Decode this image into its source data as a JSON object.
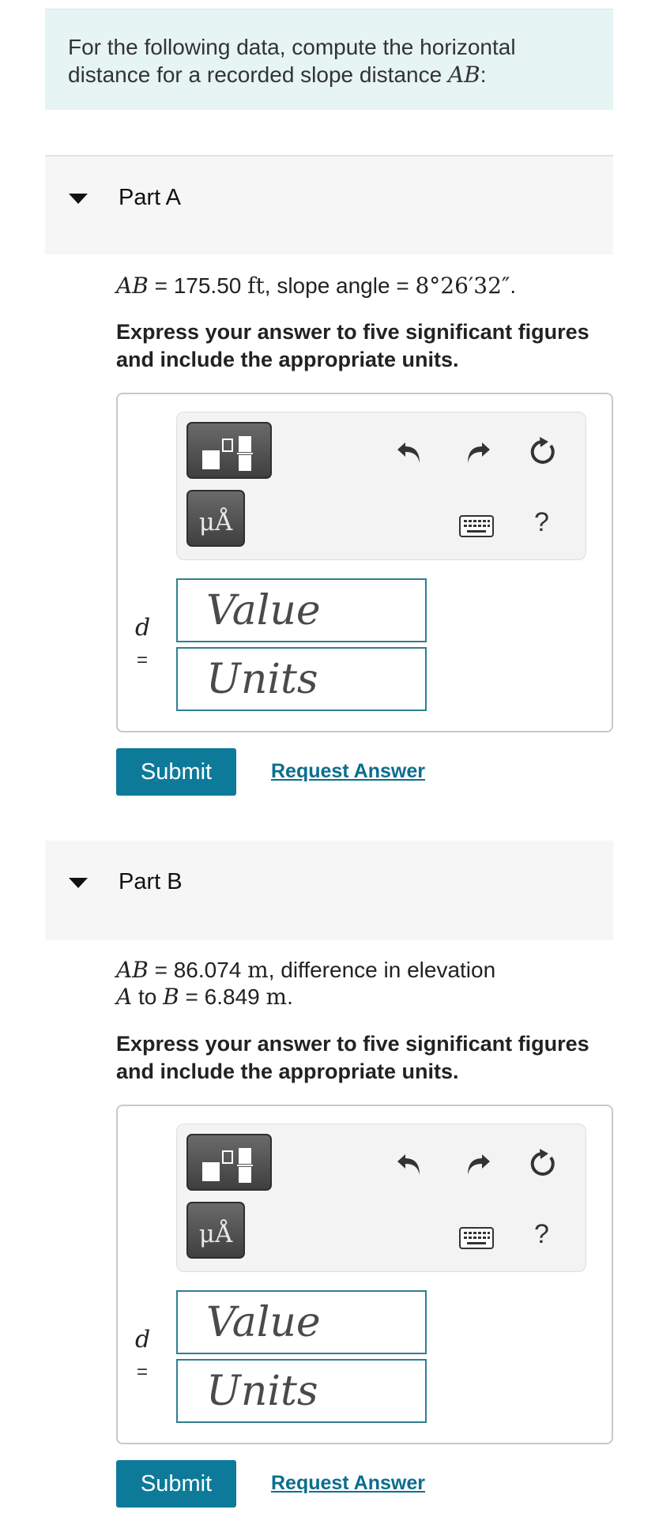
{
  "intro": {
    "text": "For the following data, compute the horizontal distance for a recorded slope distance ",
    "var": "AB",
    "suffix": ":"
  },
  "parts": [
    {
      "title": "Part A",
      "q_var": "AB",
      "q_eq": " = 175.50 ",
      "q_unit": "ft",
      "q_rest": ", slope angle = ",
      "q_angle": "8°26′32″",
      "q_end": ".",
      "instruction": "Express your answer to five significant figures and include the appropriate units.",
      "variable": "d",
      "equals": "=",
      "value_placeholder": "Value",
      "units_placeholder": "Units",
      "units_icon": "μÅ",
      "help": "?",
      "submit": "Submit",
      "request": "Request Answer"
    },
    {
      "title": "Part B",
      "q_var": "AB",
      "q_eq": " = 86.074 ",
      "q_unit": "m",
      "q_rest": ", difference in elevation",
      "q_var2": "A",
      "q_to": " to ",
      "q_var3": "B",
      "q_eq2": " = 6.849 ",
      "q_unit2": "m",
      "q_end": ".",
      "instruction": "Express your answer to five significant figures and include the appropriate units.",
      "variable": "d",
      "equals": "=",
      "value_placeholder": "Value",
      "units_placeholder": "Units",
      "units_icon": "μÅ",
      "help": "?",
      "submit": "Submit",
      "request": "Request Answer"
    }
  ],
  "colors": {
    "intro_bg": "#e6f4f3",
    "accent": "#0e7a9a",
    "field_border": "#2f7f91"
  }
}
